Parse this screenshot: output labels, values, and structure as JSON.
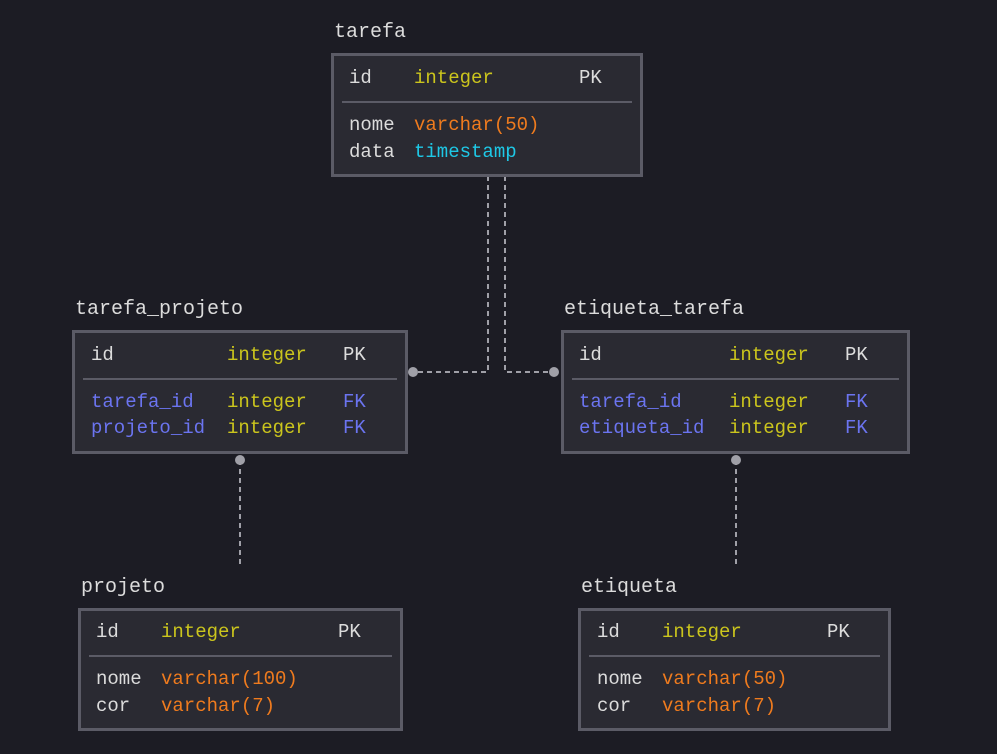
{
  "colors": {
    "background": "#1c1c24",
    "box_fill": "#2a2a32",
    "box_border": "#5b5b66",
    "text": "#dcdcdc",
    "integer": "#cbc51d",
    "varchar": "#ef7b1e",
    "timestamp": "#1ec8e6",
    "foreign_key": "#6b74f0",
    "connector": "#a0a0a8"
  },
  "entities": {
    "tarefa": {
      "name": "tarefa",
      "columns": [
        {
          "name": "id",
          "type": "integer",
          "key": "PK"
        },
        {
          "name": "nome",
          "type": "varchar(50)",
          "key": ""
        },
        {
          "name": "data",
          "type": "timestamp",
          "key": ""
        }
      ]
    },
    "tarefa_projeto": {
      "name": "tarefa_projeto",
      "columns": [
        {
          "name": "id",
          "type": "integer",
          "key": "PK"
        },
        {
          "name": "tarefa_id",
          "type": "integer",
          "key": "FK"
        },
        {
          "name": "projeto_id",
          "type": "integer",
          "key": "FK"
        }
      ]
    },
    "etiqueta_tarefa": {
      "name": "etiqueta_tarefa",
      "columns": [
        {
          "name": "id",
          "type": "integer",
          "key": "PK"
        },
        {
          "name": "tarefa_id",
          "type": "integer",
          "key": "FK"
        },
        {
          "name": "etiqueta_id",
          "type": "integer",
          "key": "FK"
        }
      ]
    },
    "projeto": {
      "name": "projeto",
      "columns": [
        {
          "name": "id",
          "type": "integer",
          "key": "PK"
        },
        {
          "name": "nome",
          "type": "varchar(100)",
          "key": ""
        },
        {
          "name": "cor",
          "type": "varchar(7)",
          "key": ""
        }
      ]
    },
    "etiqueta": {
      "name": "etiqueta",
      "columns": [
        {
          "name": "id",
          "type": "integer",
          "key": "PK"
        },
        {
          "name": "nome",
          "type": "varchar(50)",
          "key": ""
        },
        {
          "name": "cor",
          "type": "varchar(7)",
          "key": ""
        }
      ]
    }
  }
}
